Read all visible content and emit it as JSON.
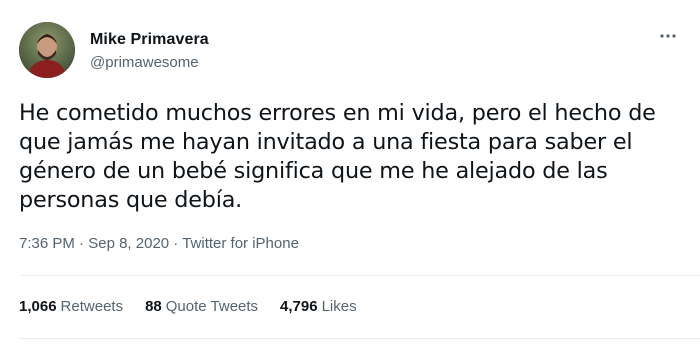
{
  "user": {
    "name": "Mike Primavera",
    "handle": "@primawesome"
  },
  "tweet": {
    "lines": [
      "He cometido muchos errores en mi vida, pero el hecho de",
      "que jamás me hayan invitado a una fiesta para saber el",
      "género de un bebé significa que me he alejado de las",
      "personas que debía."
    ],
    "time": "7:36 PM",
    "date": "Sep 8, 2020",
    "source": "Twitter for iPhone",
    "separator": "·"
  },
  "stats": {
    "retweets": {
      "count": "1,066",
      "label": "Retweets"
    },
    "quotes": {
      "count": "88",
      "label": "Quote Tweets"
    },
    "likes": {
      "count": "4,796",
      "label": "Likes"
    }
  },
  "icons": {
    "more": "more-horizontal-icon"
  },
  "colors": {
    "text": "#0f1419",
    "secondary": "#536471",
    "divider": "#e6ecf0"
  }
}
